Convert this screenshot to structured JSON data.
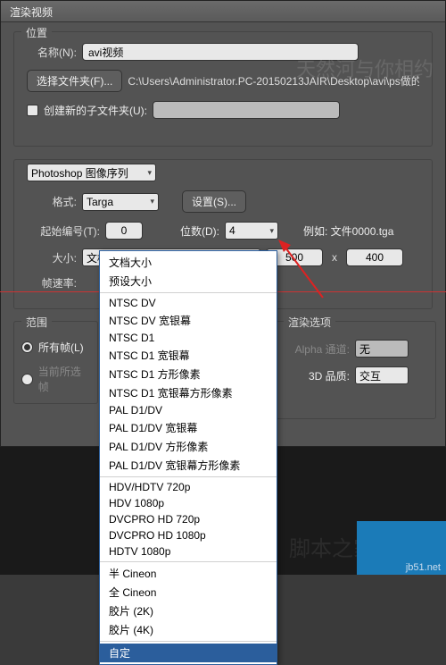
{
  "title": "渲染视频",
  "position": {
    "group_label": "位置",
    "name_label": "名称(N):",
    "name_value": "avi视频",
    "select_folder_btn": "选择文件夹(F)...",
    "path": "C:\\Users\\Administrator.PC-20150213JAIR\\Desktop\\avi\\ps做的",
    "new_subfolder_label": "创建新的子文件夹(U):"
  },
  "sequence": {
    "mode": "Photoshop 图像序列",
    "format_label": "格式:",
    "format_value": "Targa",
    "settings_btn": "设置(S)...",
    "start_num_label": "起始编号(T):",
    "start_num_value": "0",
    "digits_label": "位数(D):",
    "digits_value": "4",
    "example_label": "例如: 文件0000.tga",
    "size_label": "大小:",
    "size_value": "文档大小",
    "width_value": "500",
    "height_value": "400",
    "mult": "x",
    "fps_label": "帧速率:"
  },
  "dropdown": {
    "sections": [
      [
        "文档大小",
        "预设大小"
      ],
      [
        "NTSC DV",
        "NTSC DV 宽银幕",
        "NTSC D1",
        "NTSC D1 宽银幕",
        "NTSC D1 方形像素",
        "NTSC D1 宽银幕方形像素",
        "PAL D1/DV",
        "PAL D1/DV 宽银幕",
        "PAL D1/DV 方形像素",
        "PAL D1/DV 宽银幕方形像素"
      ],
      [
        "HDV/HDTV 720p",
        "HDV 1080p",
        "DVCPRO HD 720p",
        "DVCPRO HD 1080p",
        "HDTV 1080p"
      ],
      [
        "半 Cineon",
        "全 Cineon",
        "胶片 (2K)",
        "胶片 (4K)"
      ],
      [
        "自定"
      ]
    ],
    "selected": "自定"
  },
  "range": {
    "group_label": "范围",
    "all_frames_label": "所有帧(L)",
    "current_label": "当前所选帧"
  },
  "render": {
    "group_label": "渲染选项",
    "alpha_label": "Alpha 通道:",
    "alpha_value": "无",
    "quality_label": "3D 品质:",
    "quality_value": "交互"
  },
  "watermark1": "天然河与你相约",
  "watermark2": "脚本之家",
  "corner": "jb51.net"
}
